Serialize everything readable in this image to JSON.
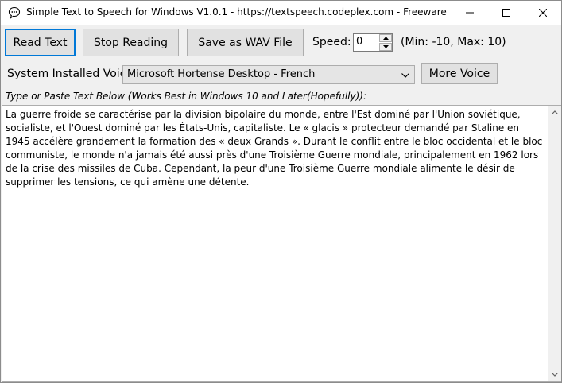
{
  "window": {
    "title": "Simple Text to Speech for Windows V1.0.1 - https://textspeech.codeplex.com - Freeware"
  },
  "toolbar": {
    "read_label": "Read Text",
    "stop_label": "Stop Reading",
    "save_label": "Save as WAV File",
    "speed_label": "Speed:",
    "speed_value": "0",
    "speed_range": "(Min: -10, Max: 10)"
  },
  "voice": {
    "label": "System Installed Voice",
    "selected": "Microsoft Hortense Desktop - French",
    "more_label": "More Voice"
  },
  "editor": {
    "hint": "Type or Paste Text Below (Works Best in Windows 10 and Later(Hopefully)):",
    "text": "La guerre froide se caractérise par la division bipolaire du monde, entre l'Est dominé par l'Union soviétique, socialiste, et l'Ouest dominé par les États-Unis, capitaliste. Le « glacis » protecteur demandé par Staline en 1945 accélère grandement la formation des « deux Grands ». Durant le conflit entre le bloc occidental et le bloc communiste, le monde n'a jamais été aussi près d'une Troisième Guerre mondiale, principalement en 1962 lors de la crise des missiles de Cuba. Cependant, la peur d'une Troisième Guerre mondiale alimente le désir de supprimer les tensions, ce qui amène une détente."
  },
  "colors": {
    "focus_border": "#0078d7",
    "button_face": "#e1e1e1",
    "window_bg": "#f0f0f0"
  }
}
